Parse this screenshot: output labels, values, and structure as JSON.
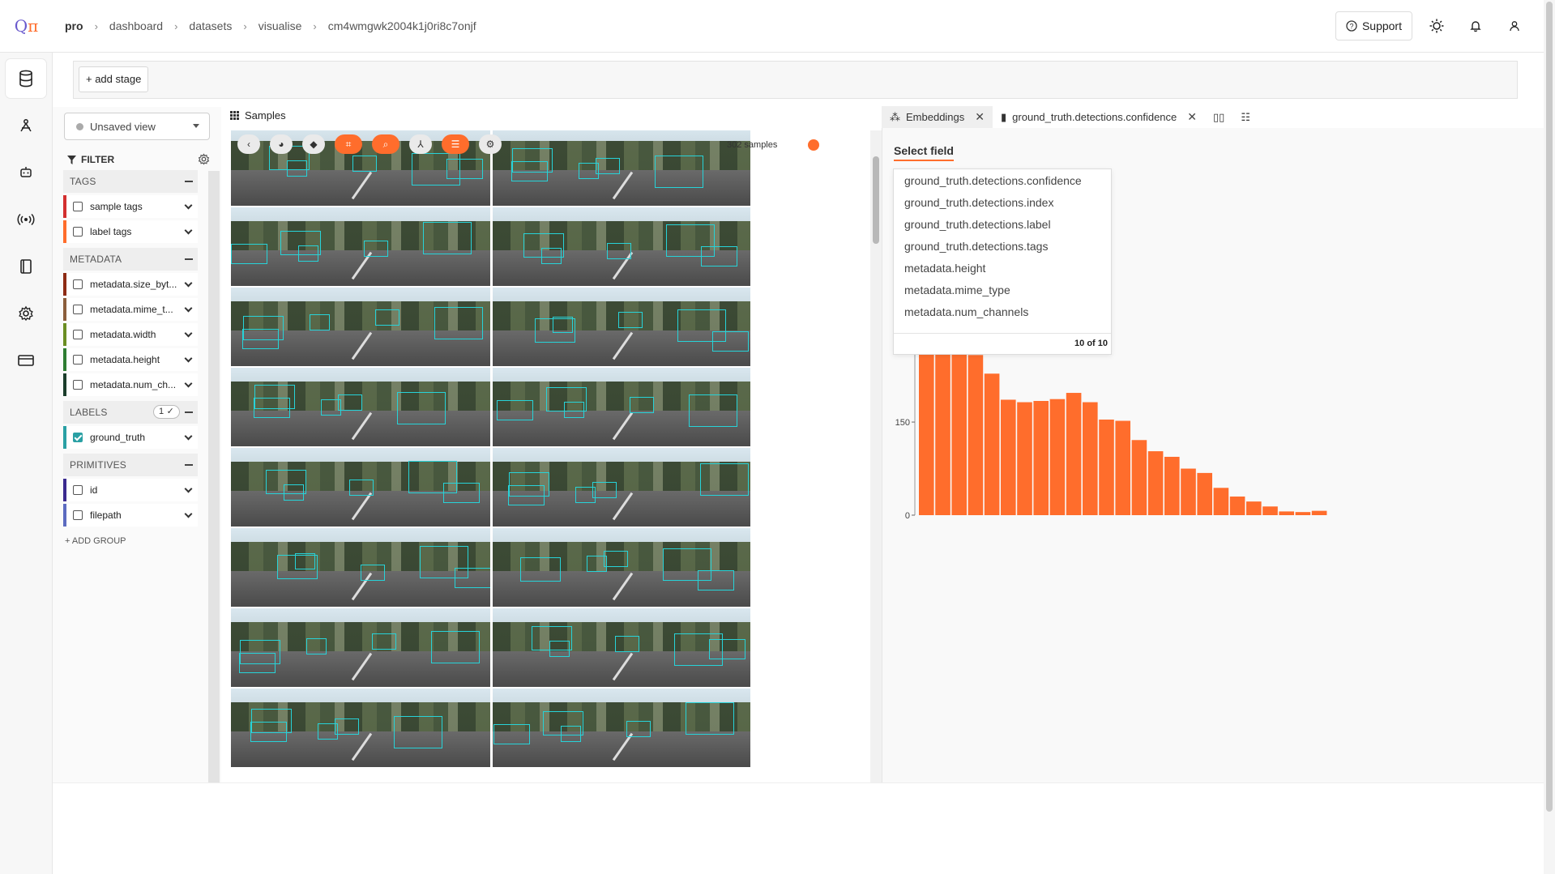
{
  "app": {
    "logo_text": "Qπ"
  },
  "breadcrumbs": [
    "pro",
    "dashboard",
    "datasets",
    "visualise",
    "cm4wmgwk2004k1j0ri8c7onjf"
  ],
  "header": {
    "support_label": "Support"
  },
  "stagebar": {
    "add_stage_label": "+ add stage"
  },
  "sidebar": {
    "view_label": "Unsaved view",
    "filter_label": "FILTER",
    "groups": [
      {
        "name": "TAGS",
        "items": [
          {
            "label": "sample tags",
            "color": "#d32f2f",
            "checked": false
          },
          {
            "label": "label tags",
            "color": "#ff6d2c",
            "checked": false
          }
        ]
      },
      {
        "name": "METADATA",
        "items": [
          {
            "label": "metadata.size_byt...",
            "color": "#8e2b14",
            "checked": false
          },
          {
            "label": "metadata.mime_t...",
            "color": "#8b5e3c",
            "checked": false
          },
          {
            "label": "metadata.width",
            "color": "#6b8e23",
            "checked": false
          },
          {
            "label": "metadata.height",
            "color": "#2e7d32",
            "checked": false
          },
          {
            "label": "metadata.num_ch...",
            "color": "#1b3d2b",
            "checked": false
          }
        ]
      },
      {
        "name": "LABELS",
        "badge": "1 ✓",
        "items": [
          {
            "label": "ground_truth",
            "color": "#2aa0a4",
            "checked": true
          }
        ]
      },
      {
        "name": "PRIMITIVES",
        "items": [
          {
            "label": "id",
            "color": "#3b2a8f",
            "checked": false
          },
          {
            "label": "filepath",
            "color": "#5c6bc0",
            "checked": false
          }
        ]
      }
    ],
    "add_group_label": "+ ADD GROUP"
  },
  "samples": {
    "tab_label": "Samples",
    "count_label": "302 samples"
  },
  "right_panel": {
    "tabs": [
      {
        "label": "Embeddings",
        "active": false
      },
      {
        "label": "ground_truth.detections.confidence",
        "active": true
      }
    ],
    "select_field_label": "Select field",
    "field_options": [
      "ground_truth.detections.confidence",
      "ground_truth.detections.index",
      "ground_truth.detections.label",
      "ground_truth.detections.tags",
      "metadata.height",
      "metadata.mime_type",
      "metadata.num_channels"
    ],
    "field_count_label": "10 of 10"
  },
  "chart_data": {
    "type": "bar",
    "title": "",
    "xlabel": "",
    "ylabel": "",
    "ylim": [
      0,
      380
    ],
    "yticks": [
      0,
      150,
      300
    ],
    "color": "#ff6d2c",
    "values": [
      370,
      270,
      275,
      258,
      228,
      186,
      182,
      184,
      187,
      197,
      182,
      154,
      152,
      121,
      103,
      94,
      75,
      68,
      44,
      30,
      22,
      14,
      6,
      5,
      7
    ]
  }
}
